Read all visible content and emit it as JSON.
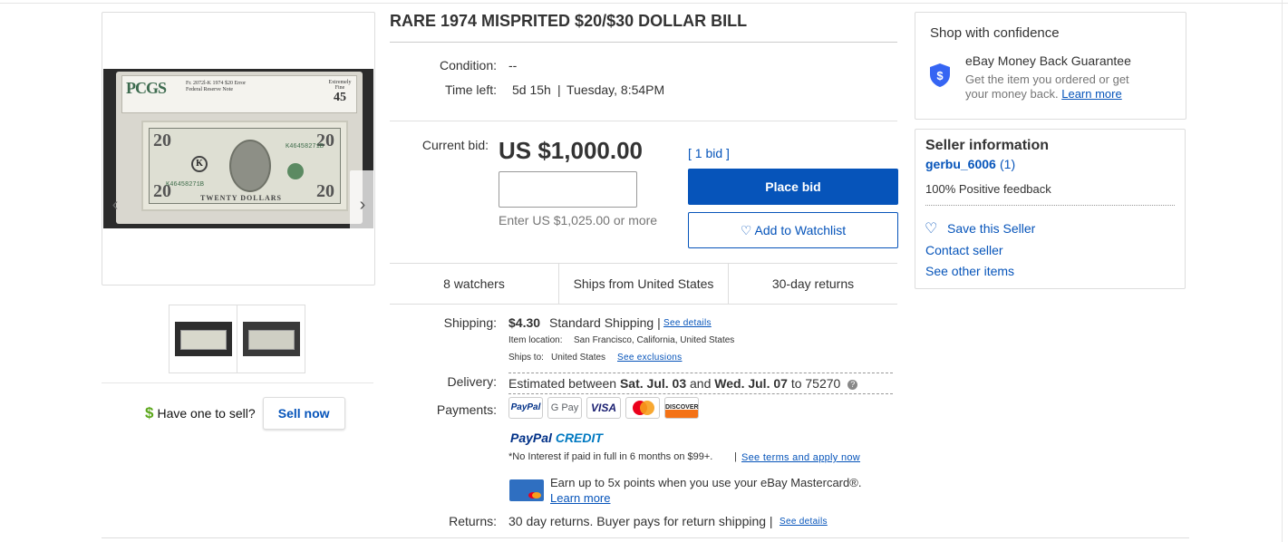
{
  "listing": {
    "title": "RARE 1974 MISPRITED $20/$30 DOLLAR BILL",
    "condition_label": "Condition:",
    "condition_value": "--",
    "time_left_label": "Time left:",
    "time_left_value": "5d 15h",
    "time_left_end": "Tuesday, 8:54PM",
    "current_bid_label": "Current bid:",
    "current_bid_value": "US $1,000.00",
    "bid_count": "[ 1 bid ]",
    "bid_hint": "Enter US $1,025.00 or more",
    "bid_input_value": "",
    "place_bid_label": "Place bid",
    "watchlist_label": "Add to Watchlist",
    "stats": [
      "8 watchers",
      "Ships from United States",
      "30-day returns"
    ]
  },
  "image": {
    "pcgs_text": "PCGS",
    "slab_line1": "Fr. 2072l-K 1974  $20 Error",
    "slab_line2": "Federal Reserve Note",
    "grade_word": "Extremely Fine",
    "grade_number": "45",
    "serial": "K46458271B",
    "note_twenty": "TWENTY DOLLARS",
    "note_denom": "20",
    "district_letter": "K"
  },
  "shipping": {
    "label": "Shipping:",
    "price": "$4.30",
    "method": "Standard Shipping |",
    "see_details": "See details",
    "location_label": "Item location:",
    "location_value": "San Francisco, California, United States",
    "ships_to_label": "Ships to:",
    "ships_to_value": "United States",
    "see_exclusions": "See exclusions"
  },
  "delivery": {
    "label": "Delivery:",
    "prefix": "Estimated between",
    "date1": "Sat. Jul. 03",
    "and": "and",
    "date2": "Wed. Jul. 07",
    "to": "to 75270"
  },
  "payments": {
    "label": "Payments:",
    "methods": [
      "PayPal",
      "G Pay",
      "VISA",
      "Mastercard",
      "DISCOVER"
    ],
    "paypal_credit_a": "PayPal",
    "paypal_credit_b": "CREDIT",
    "credit_note": "*No Interest if paid in full in 6 months on $99+.",
    "credit_sep": "|",
    "credit_link": "See terms and apply now",
    "mastercard_offer": "Earn up to 5x points when you use your eBay Mastercard®.",
    "learn_more": "Learn more"
  },
  "returns": {
    "label": "Returns:",
    "text": "30 day returns. Buyer pays for return shipping |",
    "see_details": "See details"
  },
  "confidence": {
    "heading": "Shop with confidence",
    "guarantee_title": "eBay Money Back Guarantee",
    "guarantee_text1": "Get the item you ordered or get",
    "guarantee_text2": "your money back.",
    "learn_more": "Learn more"
  },
  "seller": {
    "heading": "Seller information",
    "name": "gerbu_6006",
    "score": "(1)",
    "feedback": "100% Positive feedback",
    "save_seller": "Save this Seller",
    "contact": "Contact seller",
    "other_items": "See other items"
  },
  "sell": {
    "prompt": "Have one to sell?",
    "button": "Sell now",
    "dollar": "$"
  },
  "colors": {
    "link_blue": "#0654ba",
    "place_bid_bg": "#0654ba",
    "sell_dollar": "#5ba71b",
    "shield": "#3665f3"
  }
}
